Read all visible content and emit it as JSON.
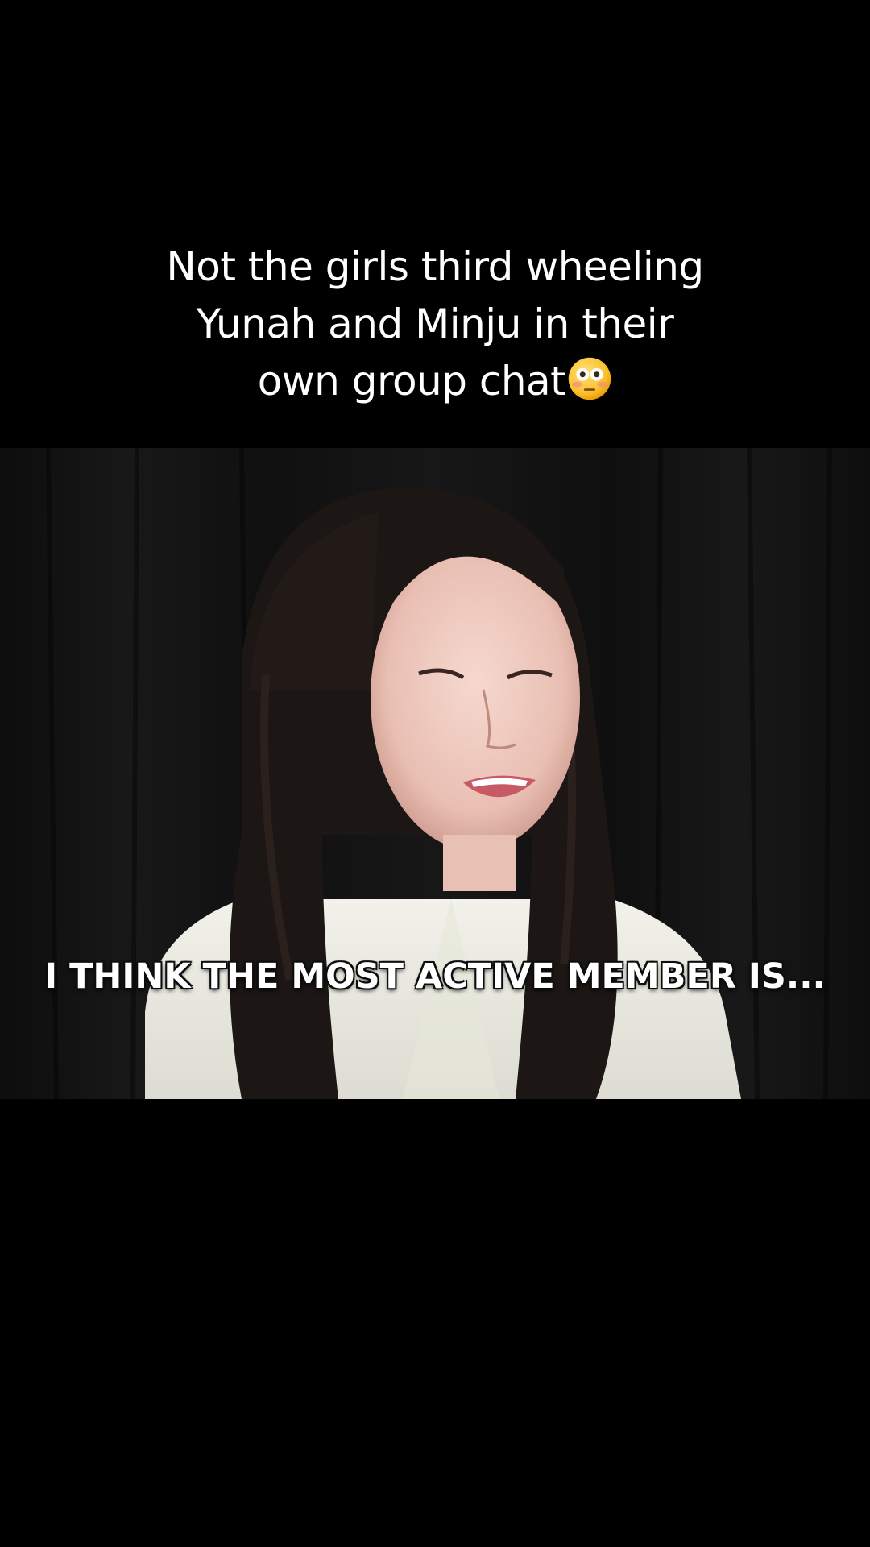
{
  "caption": {
    "line1": "Not the girls third wheeling",
    "line2": "Yunah and Minju in their",
    "line3": "own group chat",
    "emoji": "flushed-face-emoji"
  },
  "video": {
    "subtitle": "I THINK THE MOST ACTIVE MEMBER IS...",
    "background_color": "#131313"
  },
  "colors": {
    "page_background": "#000000",
    "caption_text": "#ffffff",
    "subtitle_text": "#ffffff"
  }
}
